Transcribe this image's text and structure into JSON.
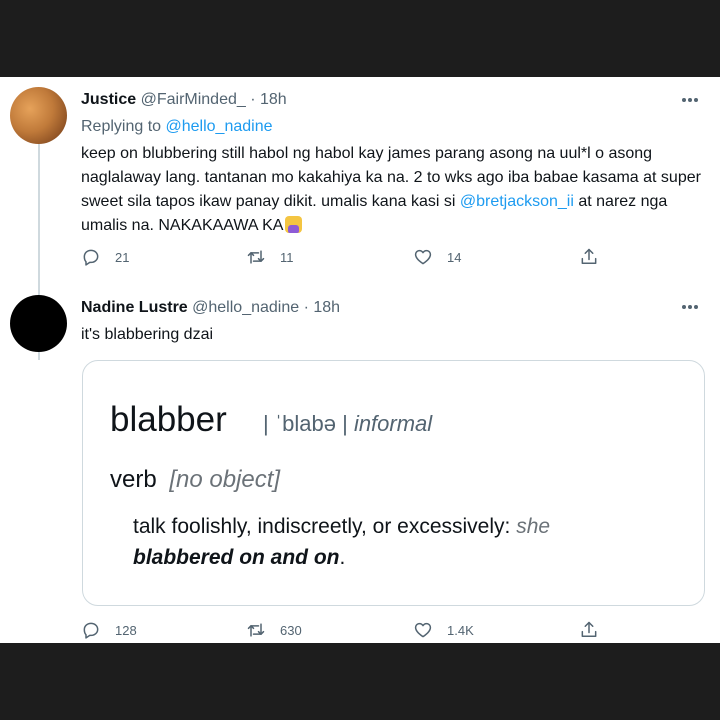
{
  "tweet1": {
    "display_name": "Justice",
    "handle": "@FairMinded_",
    "time_sep": " · ",
    "time": "18h",
    "replying_prefix": "Replying to ",
    "replying_handle": "@hello_nadine",
    "body_before_mention": "keep on blubbering still habol ng habol kay james parang asong na uul*l o asong naglalaway lang. tantanan mo kakahiya ka na. 2 to wks ago iba babae kasama at super sweet sila tapos ikaw panay dikit. umalis kana kasi si ",
    "body_mention": "@bretjackson_ii",
    "body_after_mention": " at narez nga umalis na. NAKAKAAWA KA",
    "replies": "21",
    "retweets": "11",
    "likes": "14"
  },
  "tweet2": {
    "display_name": "Nadine Lustre",
    "handle": "@hello_nadine",
    "time_sep": " · ",
    "time": "18h",
    "body": "it's blabbering dzai",
    "replies": "128",
    "retweets": "630",
    "likes": "1.4K"
  },
  "definition_card": {
    "word": "blabber",
    "pronunciation": "| ˈblabə |",
    "register": "informal",
    "part_of_speech": "verb",
    "grammar_note": "[no object]",
    "definition": "talk foolishly, indiscreetly, or excessively: ",
    "example_prefix": "she",
    "example_bold": "blabbered on and on",
    "example_end": "."
  },
  "icons": {
    "more": "more-horizontal-icon",
    "reply": "reply-bubble-icon",
    "retweet": "retweet-icon",
    "like": "heart-icon",
    "share": "share-icon",
    "emoji": "person-facepalming-emoji"
  },
  "colors": {
    "link": "#1d9bf0",
    "secondary_text": "#536471",
    "border": "#cfd9de",
    "frame": "#1d1d1d"
  }
}
